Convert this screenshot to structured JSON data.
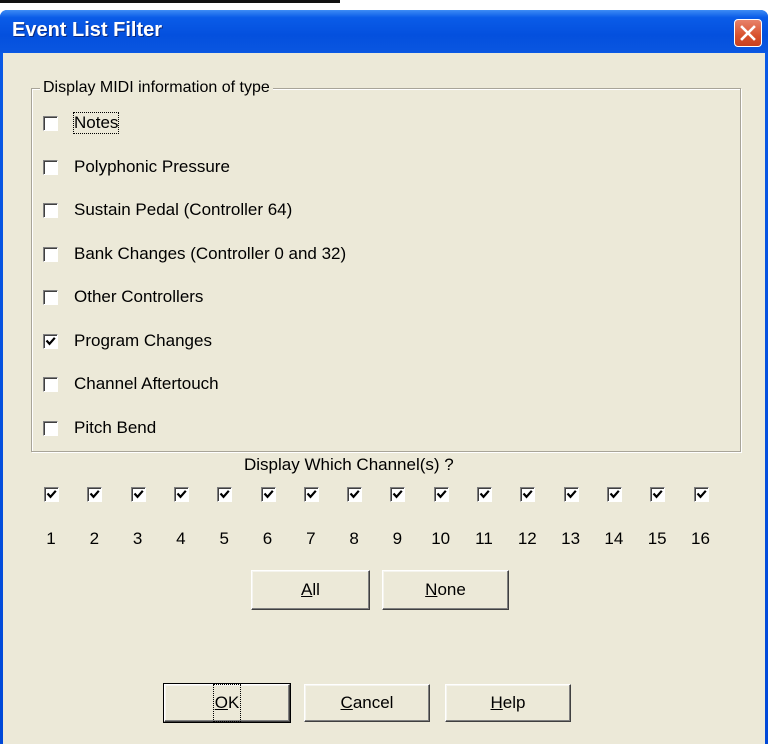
{
  "window": {
    "title": "Event List Filter"
  },
  "group": {
    "legend": "Display MIDI information  of type",
    "items": [
      {
        "label": "Notes",
        "checked": false
      },
      {
        "label": "Polyphonic Pressure",
        "checked": false
      },
      {
        "label": "Sustain Pedal (Controller 64)",
        "checked": false
      },
      {
        "label": "Bank Changes (Controller 0 and 32)",
        "checked": false
      },
      {
        "label": "Other Controllers",
        "checked": false
      },
      {
        "label": "Program Changes",
        "checked": true
      },
      {
        "label": "Channel Aftertouch",
        "checked": false
      },
      {
        "label": "Pitch Bend",
        "checked": false
      }
    ]
  },
  "channels": {
    "heading": "Display Which Channel(s) ?",
    "items": [
      {
        "label": "1",
        "checked": true
      },
      {
        "label": "2",
        "checked": true
      },
      {
        "label": "3",
        "checked": true
      },
      {
        "label": "4",
        "checked": true
      },
      {
        "label": "5",
        "checked": true
      },
      {
        "label": "6",
        "checked": true
      },
      {
        "label": "7",
        "checked": true
      },
      {
        "label": "8",
        "checked": true
      },
      {
        "label": "9",
        "checked": true
      },
      {
        "label": "10",
        "checked": true
      },
      {
        "label": "11",
        "checked": true
      },
      {
        "label": "12",
        "checked": true
      },
      {
        "label": "13",
        "checked": true
      },
      {
        "label": "14",
        "checked": true
      },
      {
        "label": "15",
        "checked": true
      },
      {
        "label": "16",
        "checked": true
      }
    ]
  },
  "buttons": {
    "all": {
      "mnemonic": "A",
      "rest": "ll"
    },
    "none": {
      "mnemonic": "N",
      "rest": "one"
    },
    "ok": {
      "mnemonic": "O",
      "rest": "K"
    },
    "cancel": {
      "mnemonic": "C",
      "rest": "ancel"
    },
    "help": {
      "mnemonic": "H",
      "rest": "elp"
    }
  },
  "colors": {
    "titlebar": "#0450de",
    "face": "#ece9d8",
    "close": "#d8522e"
  },
  "icons": {
    "close": "close-x-icon",
    "check": "checkmark-icon"
  }
}
